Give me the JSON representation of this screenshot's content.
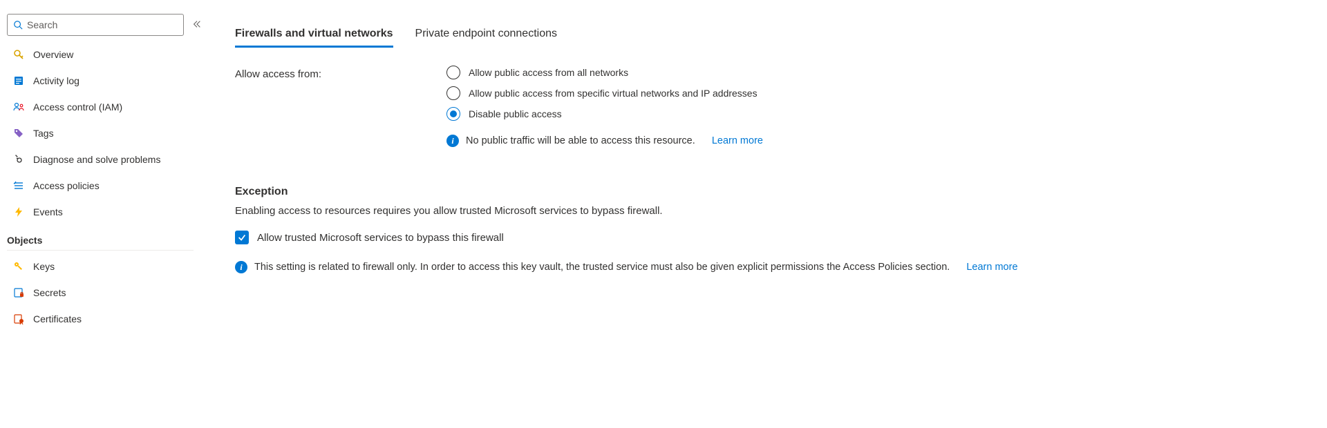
{
  "search": {
    "placeholder": "Search"
  },
  "sidebar": {
    "items": [
      {
        "label": "Overview"
      },
      {
        "label": "Activity log"
      },
      {
        "label": "Access control (IAM)"
      },
      {
        "label": "Tags"
      },
      {
        "label": "Diagnose and solve problems"
      },
      {
        "label": "Access policies"
      },
      {
        "label": "Events"
      }
    ],
    "section_objects": "Objects",
    "objects": [
      {
        "label": "Keys"
      },
      {
        "label": "Secrets"
      },
      {
        "label": "Certificates"
      }
    ]
  },
  "tabs": {
    "firewalls": "Firewalls and virtual networks",
    "private_endpoints": "Private endpoint connections"
  },
  "access": {
    "label": "Allow access from:",
    "opt_all": "Allow public access from all networks",
    "opt_specific": "Allow public access from specific virtual networks and IP addresses",
    "opt_disable": "Disable public access",
    "info_text": "No public traffic will be able to access this resource.",
    "learn_more": "Learn more"
  },
  "exception": {
    "heading": "Exception",
    "desc": "Enabling access to resources requires you allow trusted Microsoft services to bypass firewall.",
    "checkbox_label": "Allow trusted Microsoft services to bypass this firewall",
    "info_text": "This setting is related to firewall only. In order to access this key vault, the trusted service must also be given explicit permissions the Access Policies section.",
    "learn_more": "Learn more"
  }
}
